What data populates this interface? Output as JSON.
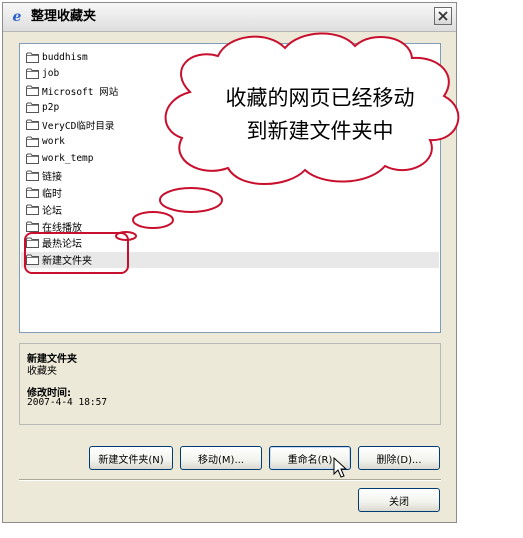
{
  "window": {
    "title": "整理收藏夹",
    "title_icon": "ie-e-icon"
  },
  "tree": {
    "items": [
      {
        "label": "buddhism"
      },
      {
        "label": "job"
      },
      {
        "label": "Microsoft 网站"
      },
      {
        "label": "p2p"
      },
      {
        "label": "VeryCD临时目录"
      },
      {
        "label": "work"
      },
      {
        "label": "work_temp"
      },
      {
        "label": "链接"
      },
      {
        "label": "临时"
      },
      {
        "label": "论坛"
      },
      {
        "label": "在线播放"
      },
      {
        "label": "最热论坛"
      },
      {
        "label": "新建文件夹"
      }
    ],
    "selected_index": 12
  },
  "info": {
    "name": "新建文件夹",
    "kind": "收藏夹",
    "modified_label": "修改时间:",
    "modified_value": "2007-4-4 18:57"
  },
  "buttons": {
    "new_folder": "新建文件夹(N)",
    "move": "移动(M)...",
    "rename": "重命名(R)",
    "delete": "删除(D)...",
    "close": "关闭"
  },
  "callout": {
    "line1": "收藏的网页已经移动",
    "line2": "到新建文件夹中"
  },
  "colors": {
    "annotation_red": "#c8102e",
    "window_bg": "#ece9d8",
    "selection_gray": "#e8e8e8"
  }
}
